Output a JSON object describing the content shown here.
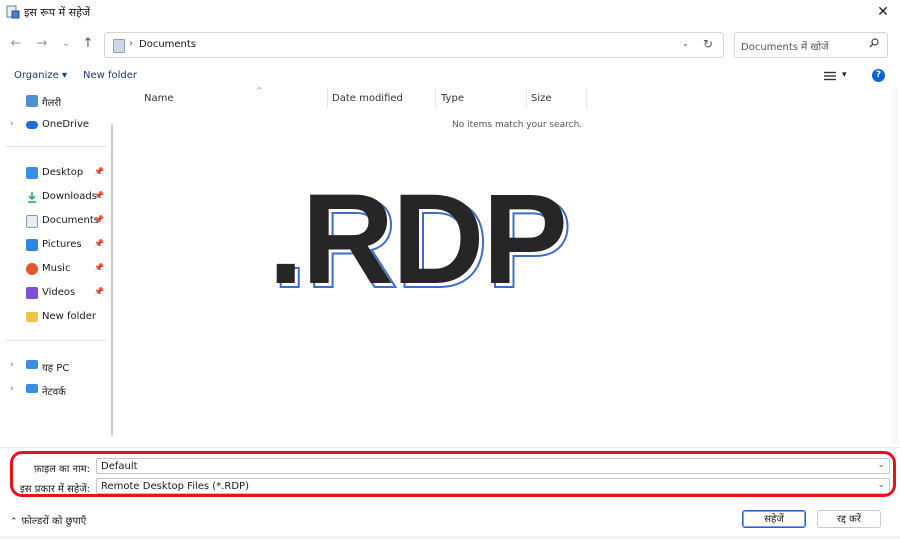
{
  "window": {
    "title": "इस रूप में सहेजें",
    "close_glyph": "✕"
  },
  "nav": {
    "back": "←",
    "forward": "→",
    "recent": "⌄",
    "up": "↑",
    "address_sep": "›",
    "address_path": "Documents",
    "address_dropdown": "⌄",
    "refresh": "↻",
    "search_placeholder": "Documents में खोजें"
  },
  "toolbar": {
    "organize": "Organize ▾",
    "new_folder": "New folder",
    "view_dropdown": "▾",
    "help": "?"
  },
  "sidebar": {
    "items": [
      {
        "label": "गैलरी",
        "chevron": "",
        "pin": "",
        "color": "#4f8fd6"
      },
      {
        "label": "OneDrive",
        "chevron": "›",
        "pin": "",
        "color": "#1f6fd0"
      },
      {
        "label": "Desktop",
        "chevron": "",
        "pin": "📌",
        "color": "#3a8ee6"
      },
      {
        "label": "Downloads",
        "chevron": "",
        "pin": "📌",
        "color": "#1aa36a"
      },
      {
        "label": "Documents",
        "chevron": "",
        "pin": "📌",
        "color": "#9aa8b8"
      },
      {
        "label": "Pictures",
        "chevron": "",
        "pin": "📌",
        "color": "#2e86de"
      },
      {
        "label": "Music",
        "chevron": "",
        "pin": "📌",
        "color": "#e4572e"
      },
      {
        "label": "Videos",
        "chevron": "",
        "pin": "📌",
        "color": "#7b4fd6"
      },
      {
        "label": "New folder",
        "chevron": "",
        "pin": "",
        "color": "#f2c14e"
      },
      {
        "label": "यह PC",
        "chevron": "›",
        "pin": "",
        "color": "#3a8ee6"
      },
      {
        "label": "नेटवर्क",
        "chevron": "›",
        "pin": "",
        "color": "#3a8ee6"
      }
    ]
  },
  "listing": {
    "columns": [
      "Name",
      "Date modified",
      "Type",
      "Size"
    ],
    "sort_caret": "^",
    "empty_message": "No items match your search."
  },
  "overlay": {
    "text": ".RDP"
  },
  "form": {
    "filename_label": "फ़ाइल का नाम:",
    "filename_value": "Default",
    "savetype_label": "इस प्रकार में सहेजें:",
    "savetype_value": "Remote Desktop Files (*.RDP)",
    "dropdown_glyph": "⌄"
  },
  "footer": {
    "hide_folders": "फ़ोल्डरों को छुपाएँ",
    "save": "सहेजें",
    "cancel": "रद्द करें"
  },
  "colors": {
    "accent": "#0a64d4",
    "highlight": "#e8121c",
    "overlay_outline": "#3f6cc6"
  }
}
